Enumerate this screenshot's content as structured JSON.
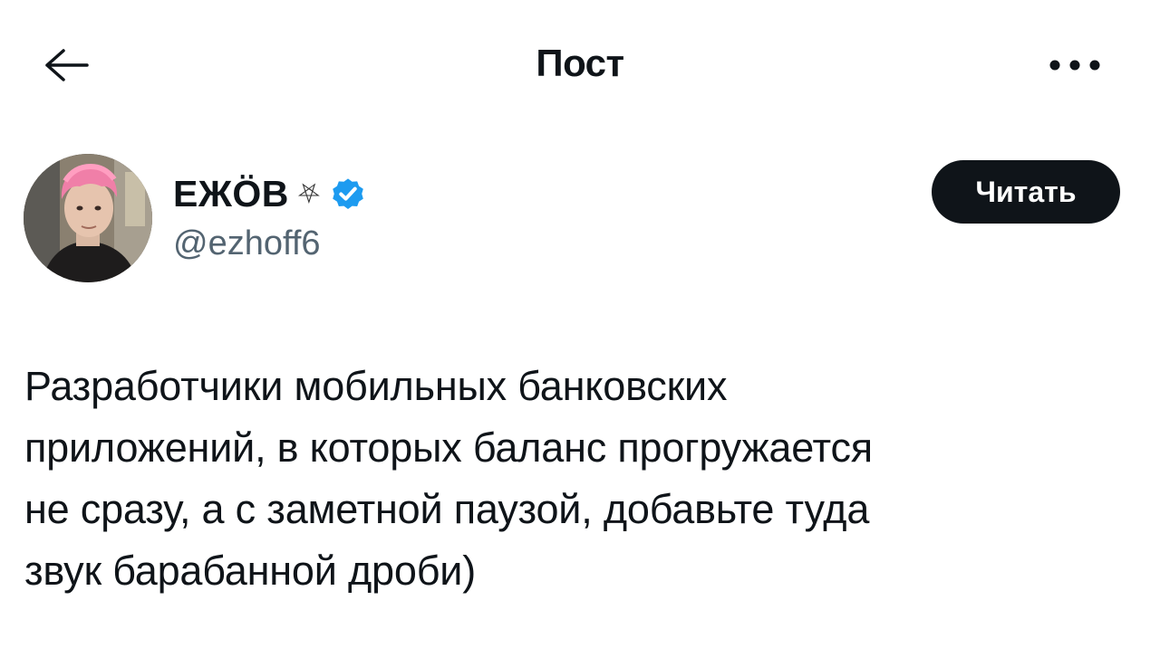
{
  "header": {
    "title": "Пост",
    "back_icon": "arrow-left-icon",
    "more_icon": "more-horizontal-icon"
  },
  "author": {
    "display_name": "ЕЖÖВ",
    "name_glyph": "⛧",
    "handle": "@ezhoff6",
    "verified_icon": "verified-badge-icon",
    "verified_color": "#1d9bf0",
    "follow_label": "Читать"
  },
  "tweet": {
    "text": "Разработчики мобильных банковских\nприложений, в которых баланс прогружается\nне сразу, а с заметной паузой, добавьте туда\nзвук барабанной дроби)"
  },
  "colors": {
    "text_primary": "#0f1419",
    "text_secondary": "#536471",
    "button_bg": "#0f1419",
    "accent": "#1d9bf0"
  }
}
